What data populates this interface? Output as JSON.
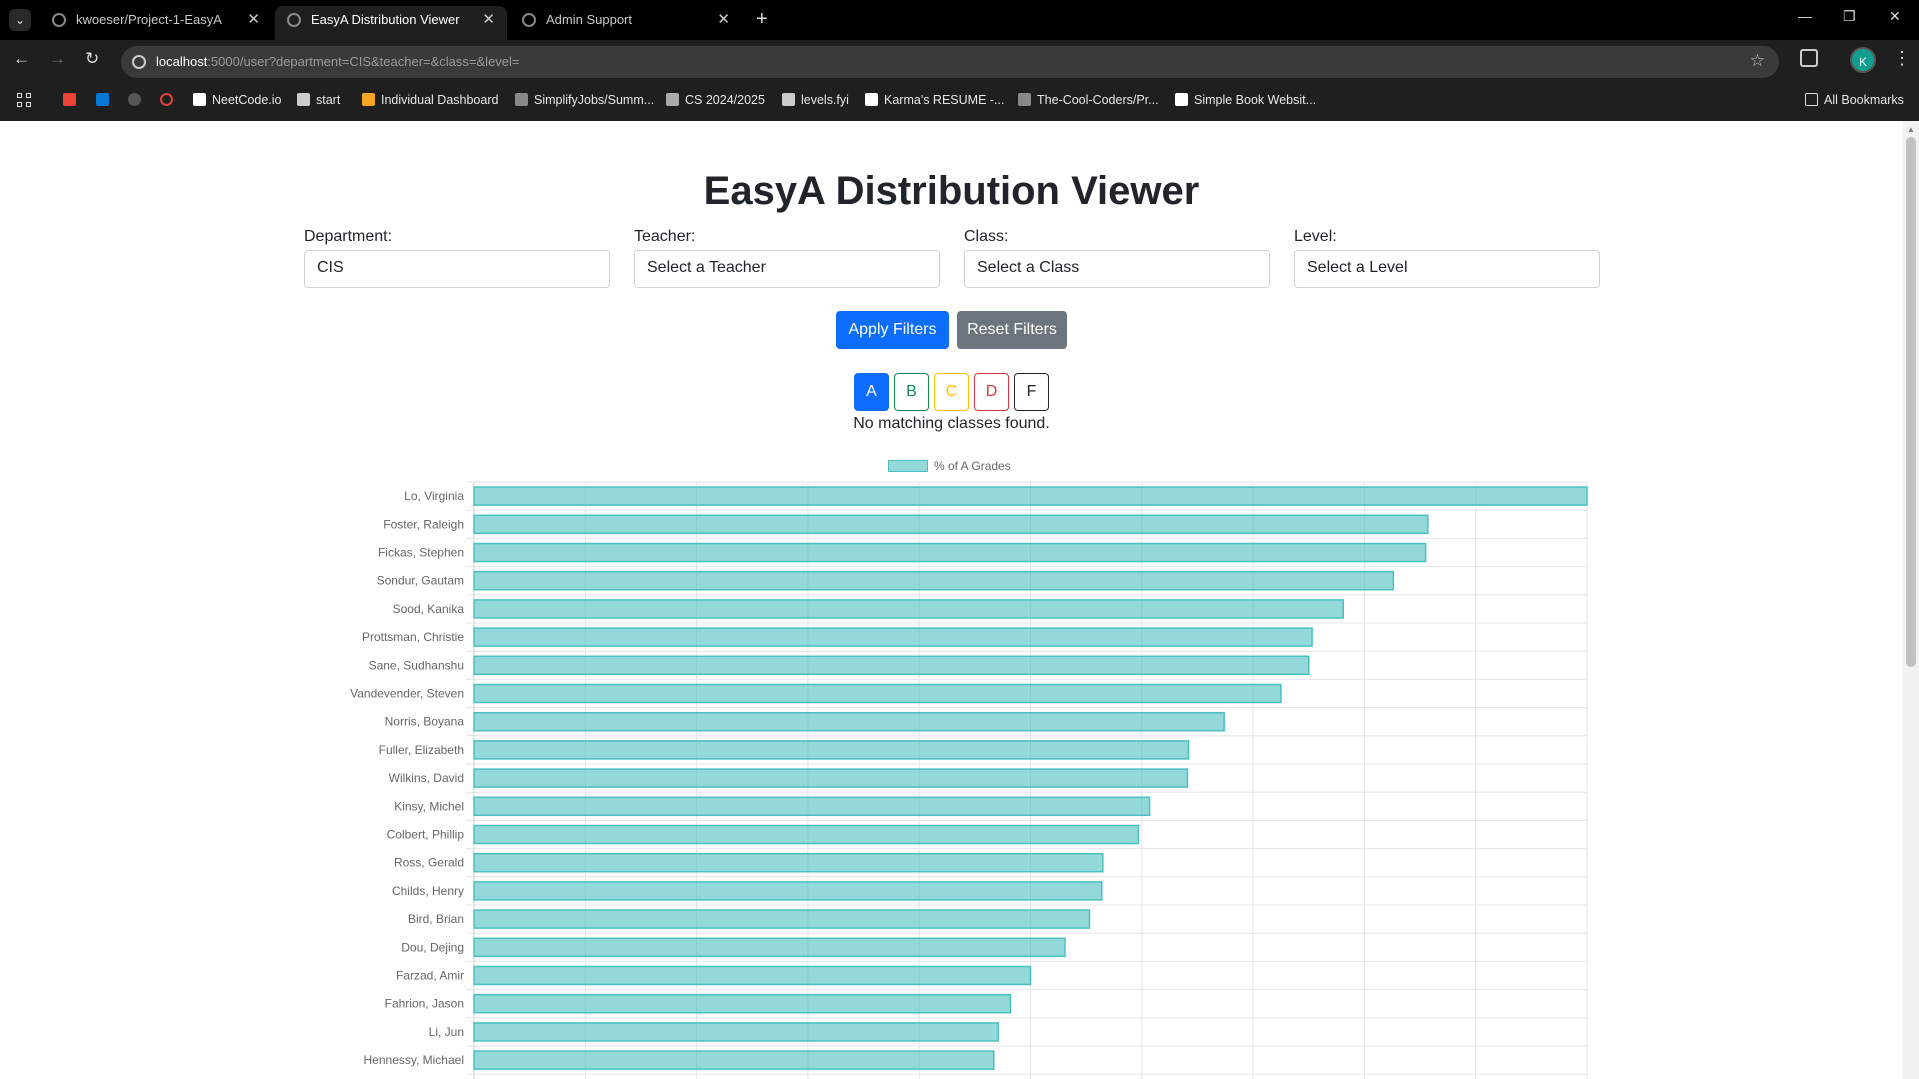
{
  "browser": {
    "tab_menu_icon": "chevron-down-icon",
    "tabs": [
      {
        "label": "kwoeser/Project-1-EasyA",
        "active": false
      },
      {
        "label": "EasyA Distribution Viewer",
        "active": true
      },
      {
        "label": "Admin Support",
        "active": false
      }
    ],
    "url_host": "localhost",
    "url_rest": ":5000/user?department=CIS&teacher=&class=&level=",
    "profile_initial": "K",
    "bookmarks": [
      {
        "label": "NeetCode.io",
        "icon_color": "#ffffff"
      },
      {
        "label": "start",
        "icon_color": "#cccccc"
      },
      {
        "label": "Individual Dashboard",
        "icon_color": "#f5a623"
      },
      {
        "label": "SimplifyJobs/Summ...",
        "icon_color": "#888888"
      },
      {
        "label": "CS 2024/2025",
        "icon_color": "#aaaaaa"
      },
      {
        "label": "levels.fyi",
        "icon_color": "#cccccc"
      },
      {
        "label": "Karma's RESUME -...",
        "icon_color": "#ffffff"
      },
      {
        "label": "The-Cool-Coders/Pr...",
        "icon_color": "#888888"
      },
      {
        "label": "Simple Book Websit...",
        "icon_color": "#ffffff"
      }
    ],
    "all_bookmarks": "All Bookmarks"
  },
  "page": {
    "title": "EasyA Distribution Viewer",
    "filters": {
      "department": {
        "label": "Department:",
        "value": "CIS"
      },
      "teacher": {
        "label": "Teacher:",
        "value": "Select a Teacher"
      },
      "class": {
        "label": "Class:",
        "value": "Select a Class"
      },
      "level": {
        "label": "Level:",
        "value": "Select a Level"
      }
    },
    "apply_label": "Apply Filters",
    "reset_label": "Reset Filters",
    "grades": [
      "A",
      "B",
      "C",
      "D",
      "F"
    ],
    "selected_grade": "A",
    "no_match": "No matching classes found.",
    "colors": {
      "primary": "#0d6efd",
      "secondary": "#6c757d",
      "bar_fill": "rgba(75,192,192,0.6)",
      "bar_border": "#4bc0c0"
    }
  },
  "chart_data": {
    "type": "bar",
    "orientation": "horizontal",
    "legend": "% of A Grades",
    "legend_position": "top",
    "grid": true,
    "xlim": [
      0,
      100
    ],
    "categories": [
      "Lo, Virginia",
      "Foster, Raleigh",
      "Fickas, Stephen",
      "Sondur, Gautam",
      "Sood, Kanika",
      "Prottsman, Christie",
      "Sane, Sudhanshu",
      "Vandevender, Steven",
      "Norris, Boyana",
      "Fuller, Elizabeth",
      "Wilkins, David",
      "Kinsy, Michel",
      "Colbert, Phillip",
      "Ross, Gerald",
      "Childs, Henry",
      "Bird, Brian",
      "Dou, Dejing",
      "Farzad, Amir",
      "Fahrion, Jason",
      "Li, Jun",
      "Hennessy, Michael"
    ],
    "series": [
      {
        "name": "% of A Grades",
        "values": [
          100,
          85.7,
          85.5,
          82.6,
          78.1,
          75.3,
          75.0,
          72.5,
          67.4,
          64.2,
          64.1,
          60.7,
          59.7,
          56.5,
          56.4,
          55.3,
          53.1,
          50.0,
          48.2,
          47.1,
          46.7
        ]
      }
    ]
  }
}
